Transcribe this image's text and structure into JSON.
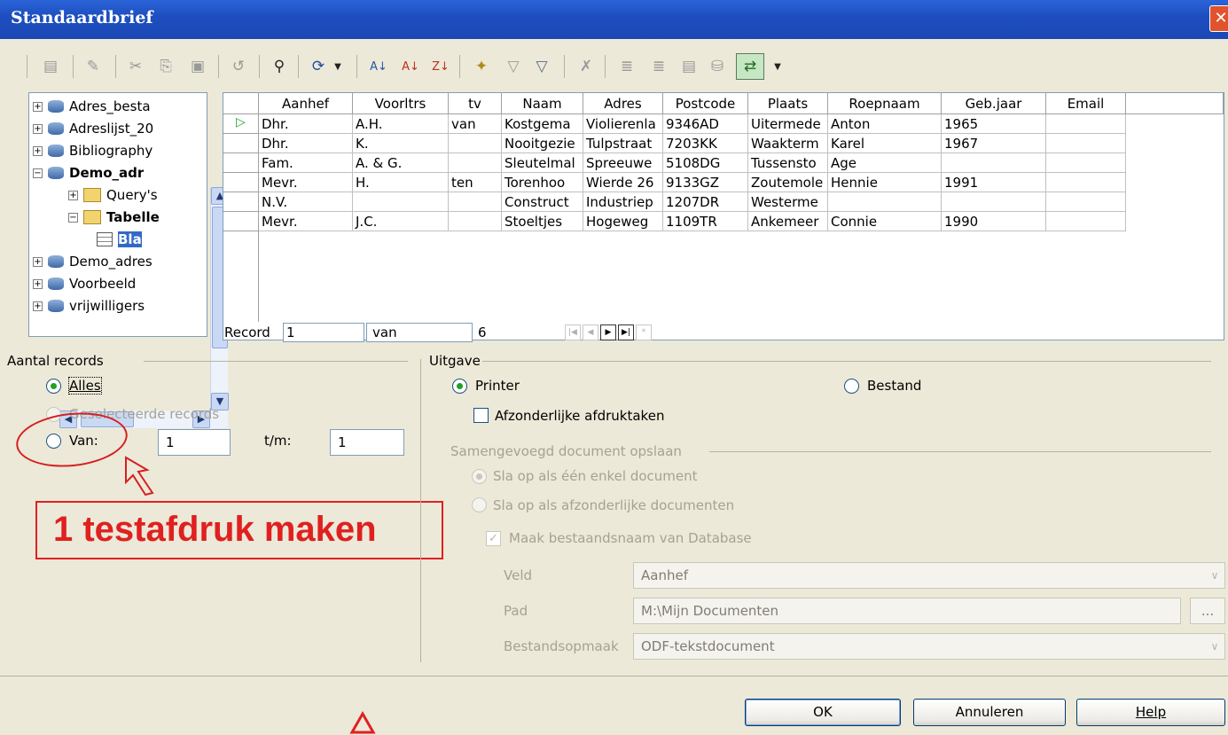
{
  "window": {
    "title": "Standaardbrief",
    "close": "✕"
  },
  "toolbar": {
    "icons": [
      "save-icon",
      "edit-icon",
      "cut-icon",
      "copy-icon",
      "paste-icon",
      "undo-icon",
      "find-icon",
      "refresh-icon",
      "sort-ascending-icon",
      "sort-az-icon",
      "sort-za-icon",
      "autofilter-icon",
      "standard-filter-icon",
      "filter-icon",
      "remove-filter-icon",
      "insert-icon",
      "data-to-text-icon",
      "data-to-fields-icon",
      "mail-merge-icon",
      "explorer-toggle-icon"
    ]
  },
  "tree": {
    "items": [
      {
        "exp": "+",
        "kind": "db",
        "label": "Adres_besta",
        "bold": false
      },
      {
        "exp": "+",
        "kind": "db",
        "label": "Adreslijst_20",
        "bold": false
      },
      {
        "exp": "+",
        "kind": "db",
        "label": "Bibliography",
        "bold": false
      },
      {
        "exp": "−",
        "kind": "db",
        "label": "Demo_adr",
        "bold": true
      },
      {
        "exp": "+",
        "kind": "folder",
        "label": "Query's",
        "bold": false
      },
      {
        "exp": "−",
        "kind": "folder",
        "label": "Tabelle",
        "bold": true
      },
      {
        "exp": "",
        "kind": "table",
        "label": "Bla",
        "bold": true
      },
      {
        "exp": "+",
        "kind": "db",
        "label": "Demo_adres",
        "bold": false
      },
      {
        "exp": "+",
        "kind": "db",
        "label": "Voorbeeld",
        "bold": false
      },
      {
        "exp": "+",
        "kind": "db",
        "label": "vrijwilligers",
        "bold": false
      }
    ]
  },
  "grid": {
    "columns": [
      "Aanhef",
      "Voorltrs",
      "tv",
      "Naam",
      "Adres",
      "Postcode",
      "Plaats",
      "Roepnaam",
      "Geb.jaar",
      "Email"
    ],
    "rows": [
      [
        "Dhr.",
        "A.H.",
        "van",
        "Kostgema",
        "Violierenla",
        "9346AD",
        "Uitermede",
        "Anton",
        "1965",
        ""
      ],
      [
        "Dhr.",
        "K.",
        "",
        "Nooitgezie",
        "Tulpstraat",
        "7203KK",
        "Waakterm",
        "Karel",
        "1967",
        ""
      ],
      [
        "Fam.",
        "A. & G.",
        "",
        "Sleutelmal",
        "Spreeuwe",
        "5108DG",
        "Tussensto",
        "Age",
        "",
        ""
      ],
      [
        "Mevr.",
        "H.",
        "ten",
        "Torenhoo",
        "Wierde 26",
        "9133GZ",
        "Zoutemole",
        "Hennie",
        "1991",
        ""
      ],
      [
        "N.V.",
        "",
        "",
        "Construct",
        "Industriep",
        "1207DR",
        "Westerme",
        "",
        "",
        ""
      ],
      [
        "Mevr.",
        "J.C.",
        "",
        "Stoeltjes",
        "Hogeweg",
        "1109TR",
        "Ankemeer",
        "Connie",
        "1990",
        ""
      ]
    ],
    "current_row_marker": "▷"
  },
  "nav": {
    "record_label": "Record",
    "record_value": "1",
    "of_label": "van",
    "total": "6",
    "buttons": [
      "|◀",
      "◀",
      "▶",
      "▶|",
      "*"
    ]
  },
  "aantal": {
    "title": "Aantal records",
    "alles": "Alles",
    "geselecteerd": "Geselecteerde records",
    "van": "Van:",
    "van_value": "1",
    "tm": "t/m:",
    "tm_value": "1"
  },
  "uitgave": {
    "title": "Uitgave",
    "printer": "Printer",
    "bestand": "Bestand",
    "afzonderlijk": "Afzonderlijke afdruktaken"
  },
  "opslaan": {
    "title": "Samengevoegd document opslaan",
    "een": "Sla op als één enkel document",
    "afz": "Sla op als afzonderlijke documenten",
    "maak": "Maak bestaandsnaam van Database",
    "veld_label": "Veld",
    "veld_value": "Aanhef",
    "pad_label": "Pad",
    "pad_value": "M:\\Mijn Documenten",
    "browse": "...",
    "opmaak_label": "Bestandsopmaak",
    "opmaak_value": "ODF-tekstdocument"
  },
  "annotation": {
    "text": "1 testafdruk maken"
  },
  "buttons": {
    "ok": "OK",
    "cancel": "Annuleren",
    "help": "Help"
  }
}
